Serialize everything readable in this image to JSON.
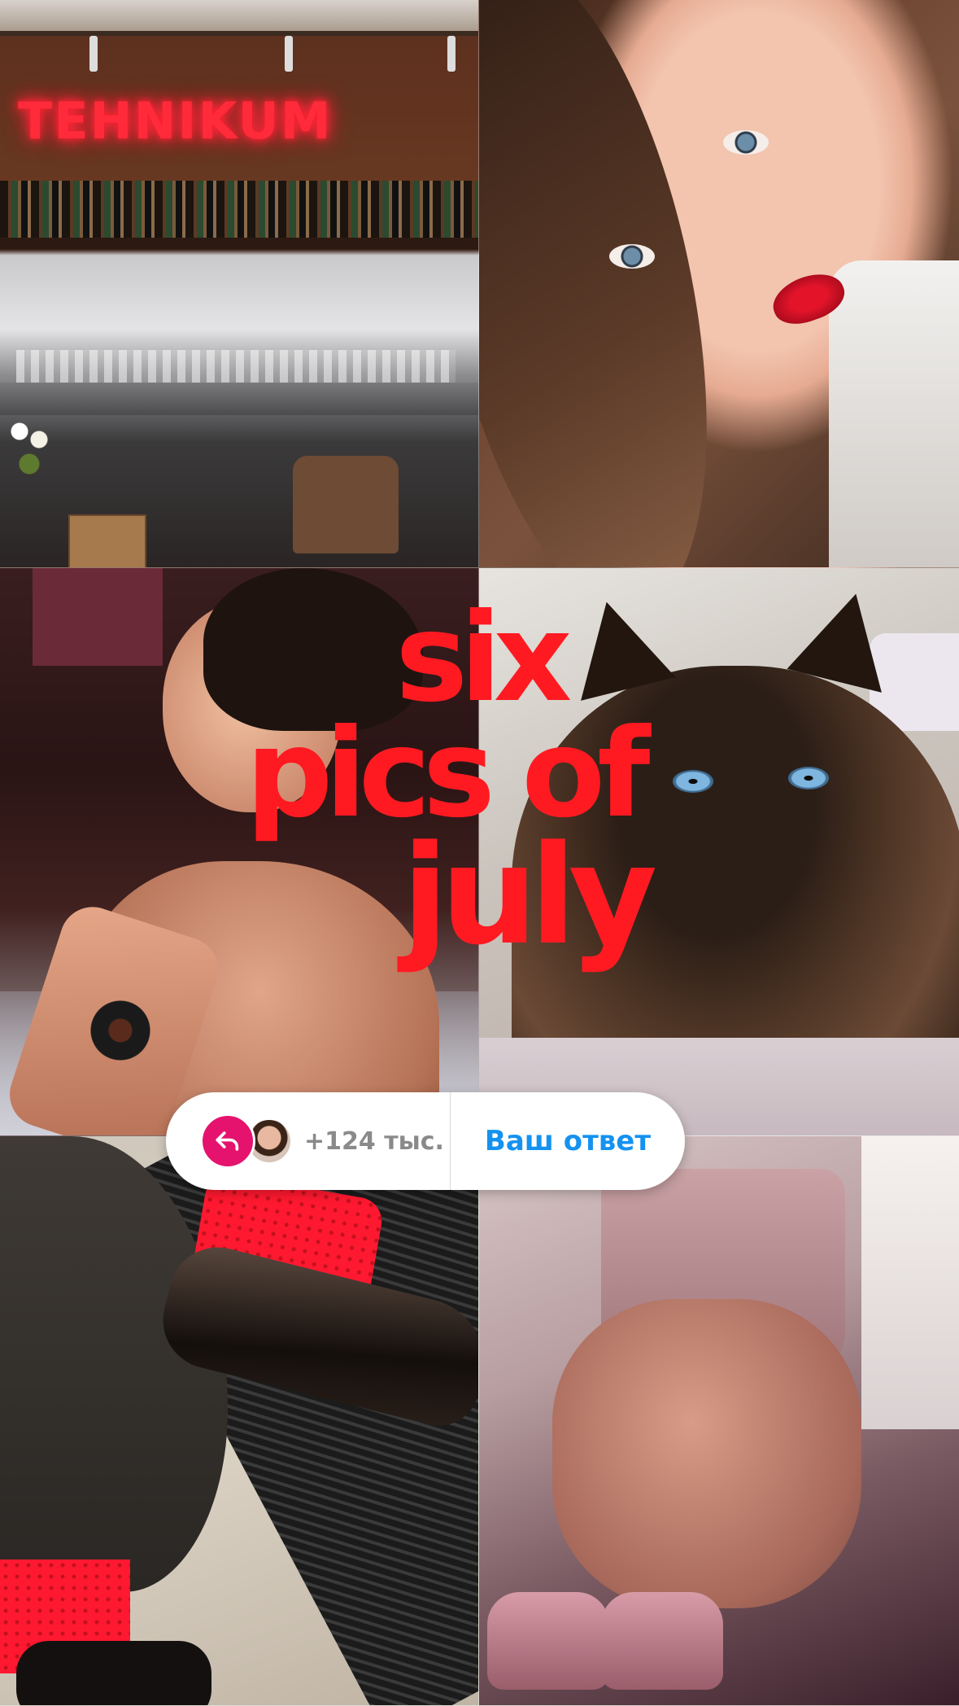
{
  "photos": [
    {
      "subject": "bar with neon sign",
      "sign_text": "TEHNIKUM"
    },
    {
      "subject": "woman selfie with red lipstick"
    },
    {
      "subject": "young man lying on bed"
    },
    {
      "subject": "siamese cat"
    },
    {
      "subject": "red socks and black loafers"
    },
    {
      "subject": "woman in pink dress and platform heels"
    }
  ],
  "title": {
    "line1": "six",
    "line2": "pics of",
    "line3": "july",
    "color": "#ff1a22"
  },
  "reply_bar": {
    "reply_icon": "reply-arrow-icon",
    "reply_icon_color": "#e5126e",
    "count": "+124 тыс.",
    "answer_label": "Ваш ответ",
    "answer_color": "#1592f0"
  }
}
